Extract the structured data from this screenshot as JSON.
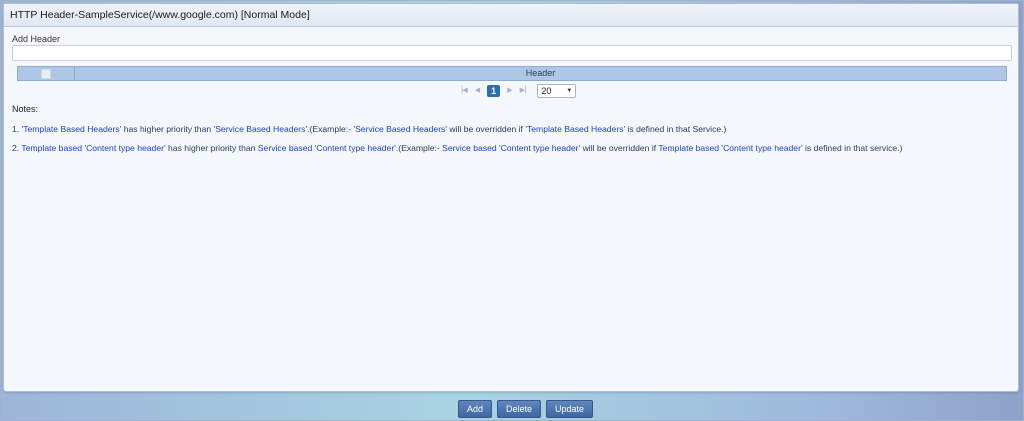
{
  "window": {
    "title": "HTTP Header-SampleService(/www.google.com) [Normal Mode]"
  },
  "add_header": {
    "label": "Add Header",
    "value": ""
  },
  "grid": {
    "column_header": "Header"
  },
  "pager": {
    "current_page": "1",
    "page_size": "20"
  },
  "notes": {
    "label": "Notes:",
    "items": [
      {
        "prefix": "1. ",
        "hl1": "'Template Based Headers'",
        "t1": " has higher priority than ",
        "hl2": "'Service Based Headers'",
        "t2": ".(Example:- ",
        "hl3": "'Service Based Headers'",
        "t3": " will be overridden if ",
        "hl4": "'Template Based Headers'",
        "t4": " is defined in that Service.)"
      },
      {
        "prefix": "2. ",
        "hl1": "Template based 'Content type header'",
        "t1": " has higher priority than ",
        "hl2": "Service based 'Content type header'",
        "t2": ".(Example:- ",
        "hl3": "Service based 'Content type header'",
        "t3": " will be overridden if ",
        "hl4": "Template based 'Content type header'",
        "t4": " is defined in that service.)"
      }
    ]
  },
  "buttons": {
    "add": "Add",
    "delete": "Delete",
    "update": "Update"
  }
}
